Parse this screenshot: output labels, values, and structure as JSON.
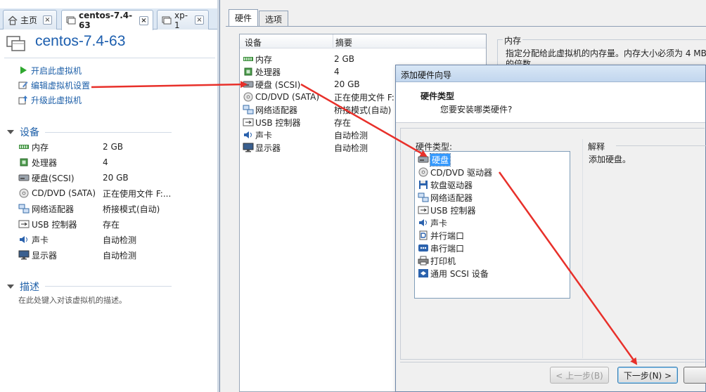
{
  "tabs": [
    {
      "label": "主页",
      "icon": "home-icon"
    },
    {
      "label": "centos-7.4-63",
      "icon": "vm-icon"
    },
    {
      "label": "xp-1",
      "icon": "vm-icon"
    }
  ],
  "tab_close_glyph": "×",
  "vm": {
    "title": "centos-7.4-63",
    "actions": [
      {
        "label": "开启此虚拟机",
        "icon": "play-icon"
      },
      {
        "label": "编辑虚拟机设置",
        "icon": "edit-settings-icon"
      },
      {
        "label": "升级此虚拟机",
        "icon": "upgrade-icon"
      }
    ],
    "devices_section": "设备",
    "devices": [
      {
        "name": "内存",
        "value": "2 GB",
        "icon": "memory-icon"
      },
      {
        "name": "处理器",
        "value": "4",
        "icon": "processor-icon"
      },
      {
        "name": "硬盘(SCSI)",
        "value": "20 GB",
        "icon": "hard-disk-icon"
      },
      {
        "name": "CD/DVD (SATA)",
        "value": "正在使用文件 F:...",
        "icon": "cd-dvd-icon"
      },
      {
        "name": "网络适配器",
        "value": "桥接模式(自动)",
        "icon": "network-adapter-icon"
      },
      {
        "name": "USB 控制器",
        "value": "存在",
        "icon": "usb-icon"
      },
      {
        "name": "声卡",
        "value": "自动检测",
        "icon": "sound-card-icon"
      },
      {
        "name": "显示器",
        "value": "自动检测",
        "icon": "display-icon"
      }
    ],
    "description_section": "描述",
    "description_placeholder": "在此处键入对该虚拟机的描述。"
  },
  "settings": {
    "tabs": [
      "硬件",
      "选项"
    ],
    "list_headers": {
      "device": "设备",
      "summary": "摘要"
    },
    "devices": [
      {
        "name": "内存",
        "value": "2 GB",
        "icon": "memory-icon"
      },
      {
        "name": "处理器",
        "value": "4",
        "icon": "processor-icon"
      },
      {
        "name": "硬盘 (SCSI)",
        "value": "20 GB",
        "icon": "hard-disk-icon"
      },
      {
        "name": "CD/DVD (SATA)",
        "value": "正在使用文件 F:",
        "icon": "cd-dvd-icon"
      },
      {
        "name": "网络适配器",
        "value": "桥接模式(自动)",
        "icon": "network-adapter-icon"
      },
      {
        "name": "USB 控制器",
        "value": "存在",
        "icon": "usb-icon"
      },
      {
        "name": "声卡",
        "value": "自动检测",
        "icon": "sound-card-icon"
      },
      {
        "name": "显示器",
        "value": "自动检测",
        "icon": "display-icon"
      }
    ],
    "memory_group_label": "内存",
    "memory_description": "指定分配给此虚拟机的内存量。内存大小必须为 4 MB 的倍数。"
  },
  "wizard": {
    "title": "添加硬件向导",
    "heading": "硬件类型",
    "subheading": "您要安装哪类硬件?",
    "hw_type_label": "硬件类型:",
    "hw_types": [
      {
        "label": "硬盘",
        "icon": "hard-disk-icon"
      },
      {
        "label": "CD/DVD 驱动器",
        "icon": "cd-dvd-icon"
      },
      {
        "label": "软盘驱动器",
        "icon": "floppy-icon"
      },
      {
        "label": "网络适配器",
        "icon": "network-adapter-icon"
      },
      {
        "label": "USB 控制器",
        "icon": "usb-icon"
      },
      {
        "label": "声卡",
        "icon": "sound-card-icon"
      },
      {
        "label": "并行端口",
        "icon": "parallel-port-icon"
      },
      {
        "label": "串行端口",
        "icon": "serial-port-icon"
      },
      {
        "label": "打印机",
        "icon": "printer-icon"
      },
      {
        "label": "通用 SCSI 设备",
        "icon": "scsi-icon"
      }
    ],
    "selected_index": 0,
    "explain_label": "解释",
    "explain_text": "添加硬盘。",
    "back_button": "< 上一步(B)",
    "next_button": "下一步(N) >"
  },
  "colors": {
    "link_blue": "#1d5fa8",
    "title_blue": "#1c5eae",
    "selection_blue": "#3399ff",
    "annotation_red": "#e8302a"
  }
}
